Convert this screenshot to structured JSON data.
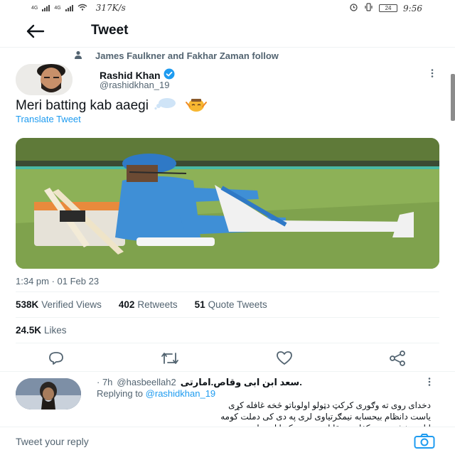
{
  "status_bar": {
    "signal_1": "4G",
    "signal_2": "4G",
    "network_speed": "317K/s",
    "battery": "24",
    "time": "9:56"
  },
  "header": {
    "title": "Tweet",
    "back_icon": "arrow-left-icon"
  },
  "social_context": {
    "icon": "person-icon",
    "text": "James Faulkner and Fakhar Zaman follow"
  },
  "tweet": {
    "author_name": "Rashid Khan",
    "verified": true,
    "author_handle": "@rashidkhan_19",
    "text": "Meri batting kab aaegi",
    "emojis": [
      "thought-bubble-emoji",
      "bowing-face-emoji"
    ],
    "translate_label": "Translate Tweet",
    "timestamp": "1:34 pm · 01 Feb 23",
    "stats": {
      "views_count": "538K",
      "views_label": "Verified Views",
      "retweets_count": "402",
      "retweets_label": "Retweets",
      "quotes_count": "51",
      "quotes_label": "Quote Tweets",
      "likes_count": "24.5K",
      "likes_label": "Likes"
    },
    "actions": [
      "reply-icon",
      "retweet-icon",
      "like-icon",
      "share-icon"
    ]
  },
  "reply": {
    "author_name": "سعد ابن ابی وقاص.امارتی.",
    "author_handle": "@hasbeellah2",
    "time": "· 7h",
    "replying_prefix": "Replying to",
    "replying_handle": "@rashidkhan_19",
    "lines": [
      "دخدای روی ته وګوری کرکټ دټولو اولوباتو څخه غافله کړی",
      "یاست دانظام بیحسابه نیمګرتیاوی لری په دی کی دملت کومه",
      "ابادی نغشتی ده دکفاره دمقابل ته جمته کېدا او دملت"
    ]
  },
  "composer": {
    "placeholder": "Tweet your reply",
    "camera_icon": "camera-icon"
  },
  "colors": {
    "accent": "#1d9bf0",
    "text": "#0f1419",
    "secondary": "#536471"
  }
}
